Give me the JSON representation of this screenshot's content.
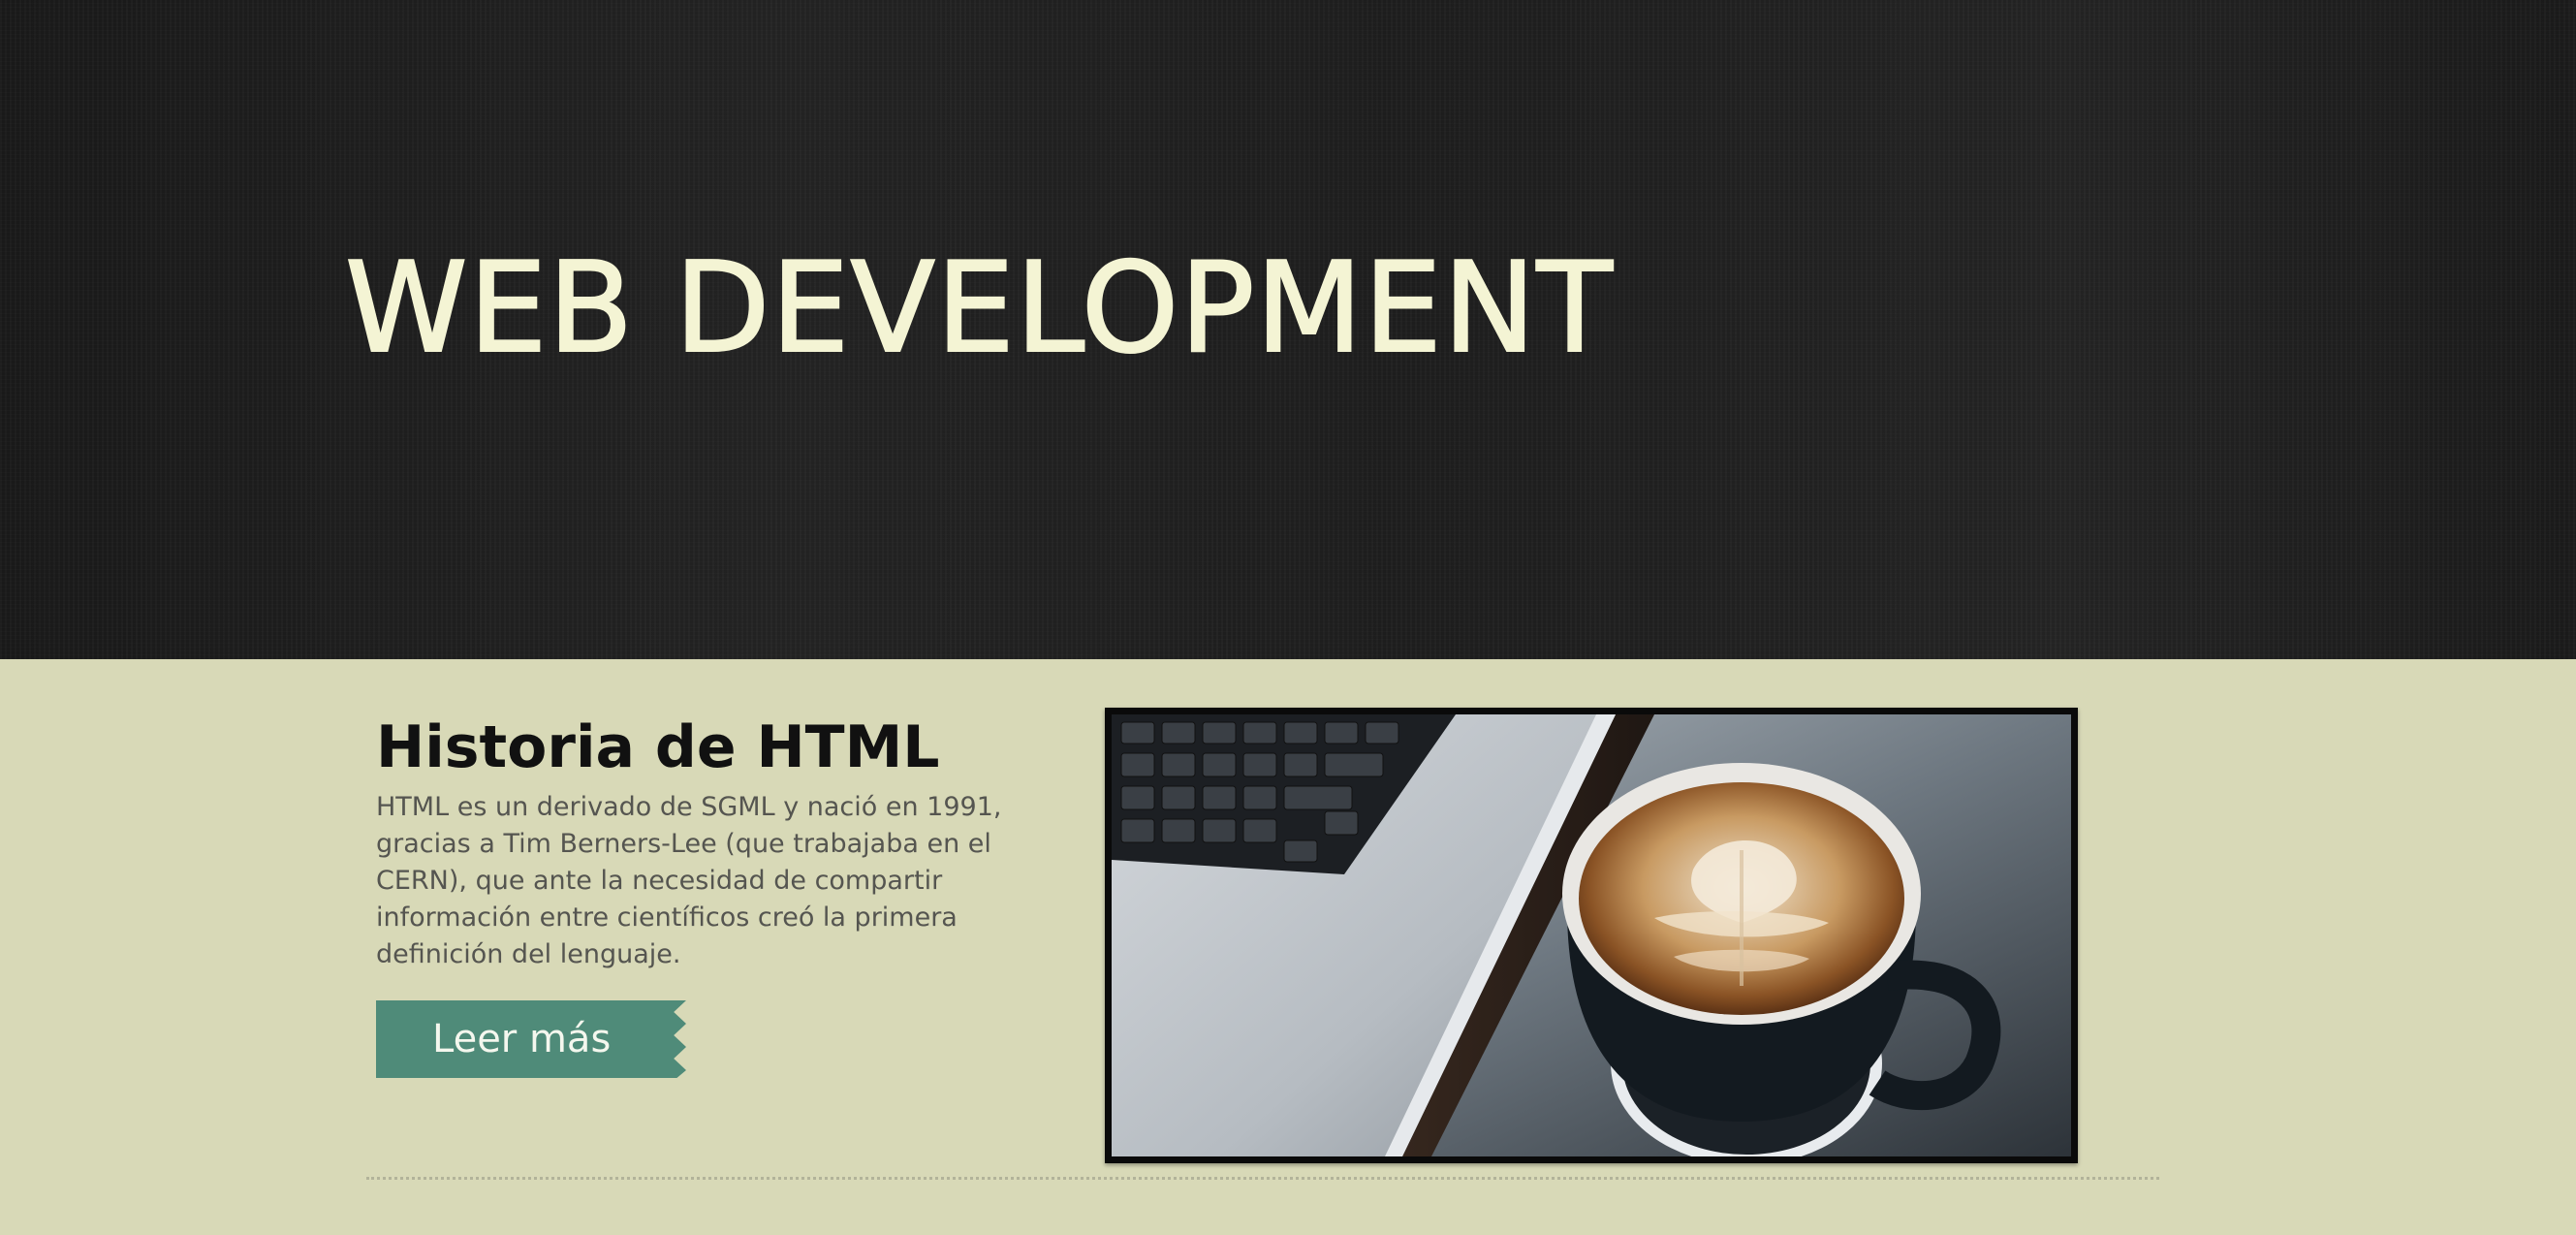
{
  "hero": {
    "title": "WEB DEVELOPMENT"
  },
  "article": {
    "title": "Historia de HTML",
    "body": "HTML es un derivado de SGML y nació en 1991, gracias a Tim Berners-Lee (que trabajaba en el CERN), que ante la necesidad de compartir información entre científicos creó la primera definición del lenguaje.",
    "button_label": "Leer más"
  },
  "colors": {
    "hero_background": "#1c1c1c",
    "hero_text": "#f4f4d4",
    "content_background": "#d8d9b7",
    "button_background": "#4f8b79",
    "button_text": "#f4f7ee"
  },
  "image": {
    "subject": "laptop-and-latte-photo"
  }
}
